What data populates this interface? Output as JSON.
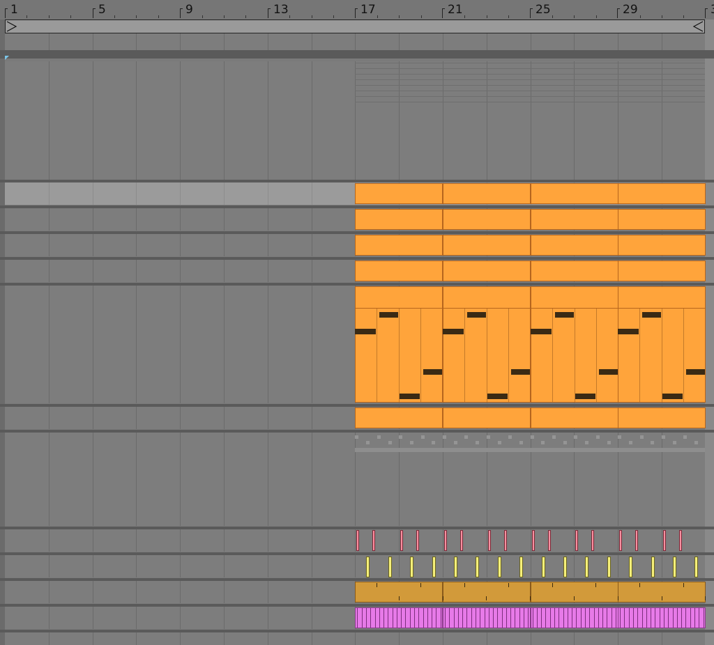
{
  "arrangement": {
    "bar_numbers": [
      "1",
      "5",
      "9",
      "13",
      "17",
      "21",
      "25",
      "29",
      "3"
    ],
    "colors": {
      "clip_orange": "#ffa43b",
      "clip_brown": "#d29a3a",
      "clip_purple": "#e77ae8",
      "note_pink": "#ff8fa0",
      "note_yellow": "#f6f07a",
      "loop_start": "#7cc6e8"
    },
    "icons": {
      "loop_start": "loop-start-icon",
      "loop_end": "loop-end-icon"
    }
  }
}
